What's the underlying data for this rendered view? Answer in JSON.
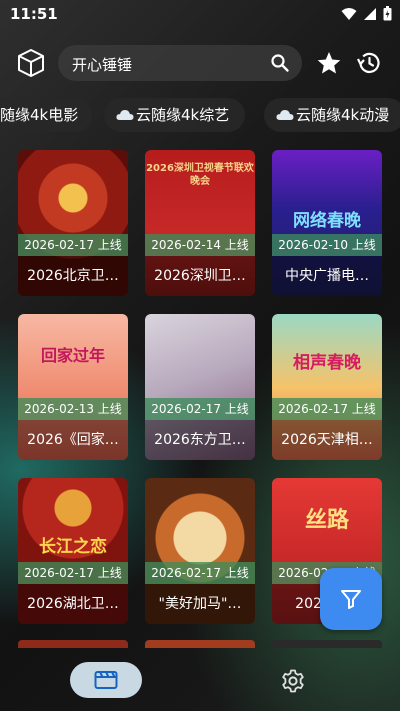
{
  "status_bar": {
    "time": "11:51"
  },
  "search": {
    "value": "开心锤锤"
  },
  "chips": [
    {
      "label": "随缘4k电影"
    },
    {
      "label": "云随缘4k综艺"
    },
    {
      "label": "云随缘4k动漫"
    }
  ],
  "cards": [
    {
      "date": "2026-02-17 上线",
      "title": "2026北京卫…",
      "accent": "#b3261e"
    },
    {
      "date": "2026-02-14 上线",
      "title": "2026深圳卫…",
      "accent": "#c0392b"
    },
    {
      "date": "2026-02-10 上线",
      "title": "中央广播电…",
      "accent": "#3b2a8f"
    },
    {
      "date": "2026-02-13 上线",
      "title": "2026《回家…",
      "accent": "#e85d4a"
    },
    {
      "date": "2026-02-17 上线",
      "title": "2026东方卫…",
      "accent": "#8c7a8f"
    },
    {
      "date": "2026-02-17 上线",
      "title": "2026天津相…",
      "accent": "#d9534f"
    },
    {
      "date": "2026-02-17 上线",
      "title": "2026湖北卫…",
      "accent": "#9c1f1a"
    },
    {
      "date": "2026-02-17 上线",
      "title": "\"美好加马\"…",
      "accent": "#7a3b1c"
    },
    {
      "date": "2026-02-17 上线",
      "title": "2026附…",
      "accent": "#c62828"
    }
  ],
  "poster_texts": [
    "2026深圳卫视春节联欢晚会",
    "网络春晚",
    "回家过年",
    "相声春晚",
    "长江之恋",
    "丝路"
  ],
  "icons": {
    "app": "cube-icon",
    "search": "search-icon",
    "favorite": "star-icon",
    "history": "history-icon",
    "chip": "cloud-icon",
    "filter": "filter-icon",
    "tab_movies": "film-icon",
    "tab_settings": "gear-icon"
  },
  "colors": {
    "fab": "#3d8bf0",
    "date_bar": "#3c8c5a",
    "nav_active": "#c9d9e3"
  }
}
